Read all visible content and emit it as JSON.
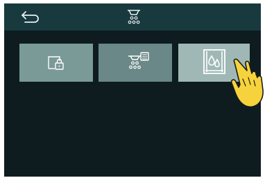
{
  "header": {
    "back_icon": "back-arrow-icon",
    "title_icon": "shower-head-icon"
  },
  "tiles": [
    {
      "icon": "door-lock-icon",
      "selected": false
    },
    {
      "icon": "shower-tank-icon",
      "selected": false
    },
    {
      "icon": "shower-cabin-icon",
      "selected": true
    }
  ],
  "overlay": {
    "icon": "hand-pointer-icon"
  },
  "colors": {
    "background": "#0e1c1f",
    "header": "#183a3e",
    "tile": "#7a9a98",
    "tile_selected": "#9fb8b6",
    "icon_stroke": "#ffffff",
    "hand": "#f6d33c"
  }
}
